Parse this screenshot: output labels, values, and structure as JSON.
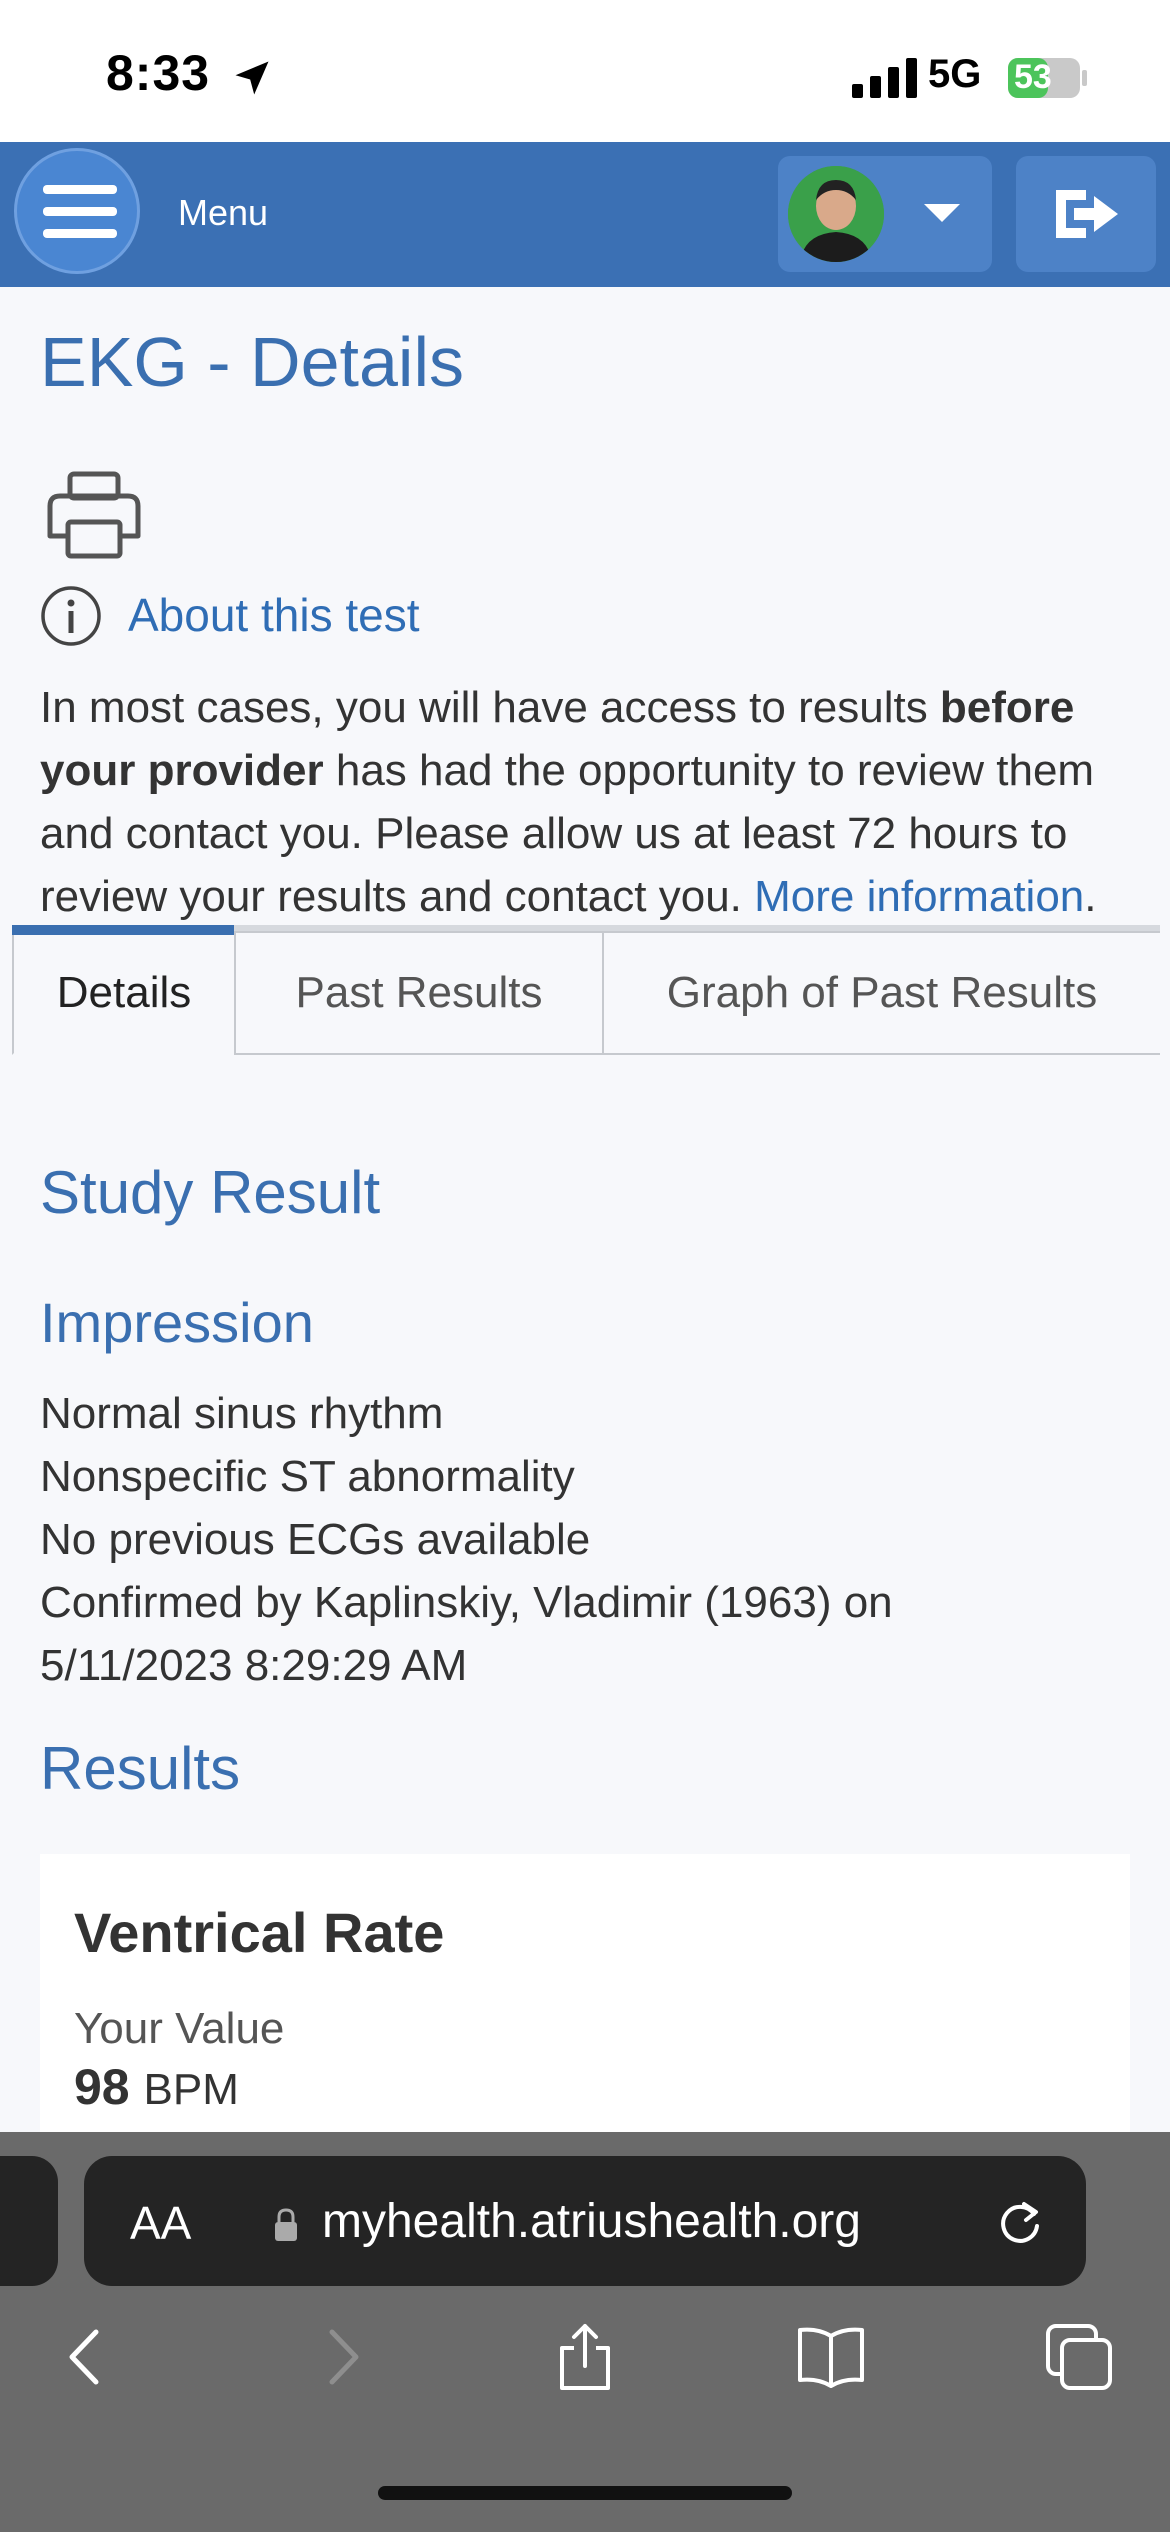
{
  "status_bar": {
    "time": "8:33",
    "network": "5G",
    "battery": "53"
  },
  "nav": {
    "menu_label": "Menu"
  },
  "page": {
    "title": "EKG - Details",
    "about_link": "About this test",
    "notice": {
      "part1": "In most cases, you will have access to results ",
      "bold": "before your provider",
      "part2": " has had the opportunity to review them and contact you. Please allow us at least 72 hours to review your results and contact you. ",
      "link": "More information",
      "end": "."
    }
  },
  "tabs": [
    {
      "label": "Details",
      "active": true
    },
    {
      "label": "Past Results",
      "active": false
    },
    {
      "label": "Graph of Past Results",
      "active": false
    }
  ],
  "study_result": {
    "heading": "Study Result",
    "impression_heading": "Impression",
    "impression_lines": [
      "Normal sinus rhythm",
      "Nonspecific ST abnormality",
      "No previous ECGs available",
      "Confirmed by Kaplinskiy, Vladimir (1963) on",
      "5/11/2023 8:29:29 AM"
    ],
    "results_heading": "Results"
  },
  "result_card": {
    "title": "Ventrical Rate",
    "label": "Your Value",
    "value": "98",
    "unit": "BPM"
  },
  "browser": {
    "aa_label": "AA",
    "url": "myhealth.atriushealth.org"
  },
  "icons": {
    "menu": "hamburger-icon",
    "logout": "logout-icon",
    "print": "printer-icon",
    "info": "info-circle-icon"
  },
  "colors": {
    "accent": "#3a6fb0",
    "nav_bg": "#3b70b4",
    "link": "#2f6db5"
  }
}
